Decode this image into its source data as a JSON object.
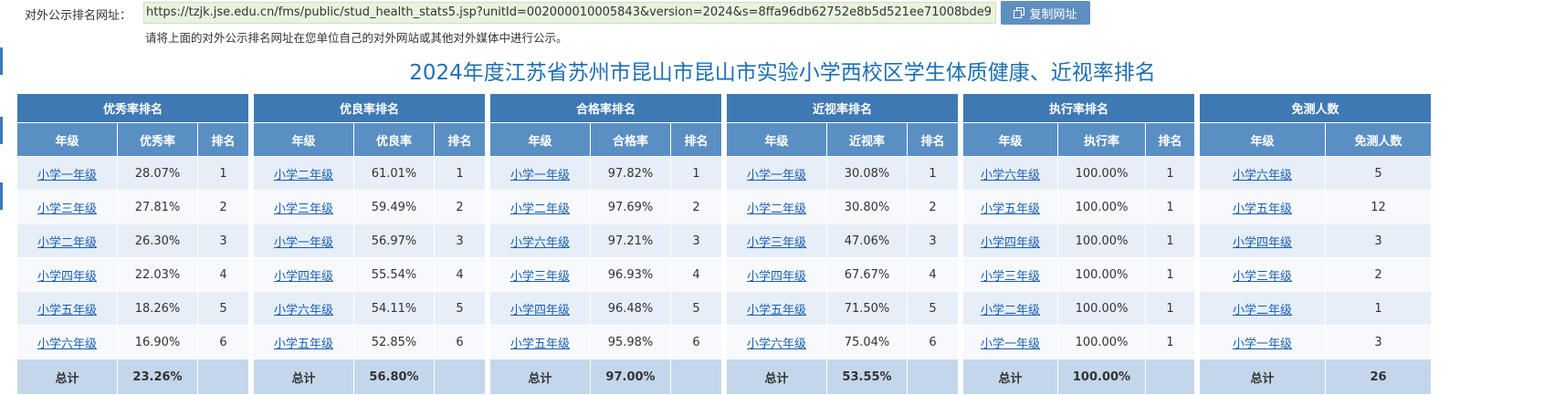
{
  "header": {
    "url_label": "对外公示排名网址：",
    "url": "https://tzjk.jse.edu.cn/fms/public/stud_health_stats5.jsp?unitId=002000010005843&version=2024&s=8ffa96db62752e8b5d521ee71008bde9",
    "copy_button": "复制网址",
    "hint": "请将上面的对外公示排名网址在您单位自己的对外网站或其他对外媒体中进行公示。"
  },
  "title": "2024年度江苏省苏州市昆山市昆山市实验小学西校区学生体质健康、近视率排名",
  "tables": [
    {
      "title": "优秀率排名",
      "col_grade": "年级",
      "col_value": "优秀率",
      "col_rank": "排名",
      "rows": [
        {
          "grade": "小学一年级",
          "value": "28.07%",
          "rank": "1"
        },
        {
          "grade": "小学三年级",
          "value": "27.81%",
          "rank": "2"
        },
        {
          "grade": "小学二年级",
          "value": "26.30%",
          "rank": "3"
        },
        {
          "grade": "小学四年级",
          "value": "22.03%",
          "rank": "4"
        },
        {
          "grade": "小学五年级",
          "value": "18.26%",
          "rank": "5"
        },
        {
          "grade": "小学六年级",
          "value": "16.90%",
          "rank": "6"
        }
      ],
      "total_label": "总计",
      "total_value": "23.26%"
    },
    {
      "title": "优良率排名",
      "col_grade": "年级",
      "col_value": "优良率",
      "col_rank": "排名",
      "rows": [
        {
          "grade": "小学二年级",
          "value": "61.01%",
          "rank": "1"
        },
        {
          "grade": "小学三年级",
          "value": "59.49%",
          "rank": "2"
        },
        {
          "grade": "小学一年级",
          "value": "56.97%",
          "rank": "3"
        },
        {
          "grade": "小学四年级",
          "value": "55.54%",
          "rank": "4"
        },
        {
          "grade": "小学六年级",
          "value": "54.11%",
          "rank": "5"
        },
        {
          "grade": "小学五年级",
          "value": "52.85%",
          "rank": "6"
        }
      ],
      "total_label": "总计",
      "total_value": "56.80%"
    },
    {
      "title": "合格率排名",
      "col_grade": "年级",
      "col_value": "合格率",
      "col_rank": "排名",
      "rows": [
        {
          "grade": "小学一年级",
          "value": "97.82%",
          "rank": "1"
        },
        {
          "grade": "小学二年级",
          "value": "97.69%",
          "rank": "2"
        },
        {
          "grade": "小学六年级",
          "value": "97.21%",
          "rank": "3"
        },
        {
          "grade": "小学三年级",
          "value": "96.93%",
          "rank": "4"
        },
        {
          "grade": "小学四年级",
          "value": "96.48%",
          "rank": "5"
        },
        {
          "grade": "小学五年级",
          "value": "95.98%",
          "rank": "6"
        }
      ],
      "total_label": "总计",
      "total_value": "97.00%"
    },
    {
      "title": "近视率排名",
      "col_grade": "年级",
      "col_value": "近视率",
      "col_rank": "排名",
      "rows": [
        {
          "grade": "小学一年级",
          "value": "30.08%",
          "rank": "1"
        },
        {
          "grade": "小学二年级",
          "value": "30.80%",
          "rank": "2"
        },
        {
          "grade": "小学三年级",
          "value": "47.06%",
          "rank": "3"
        },
        {
          "grade": "小学四年级",
          "value": "67.67%",
          "rank": "4"
        },
        {
          "grade": "小学五年级",
          "value": "71.50%",
          "rank": "5"
        },
        {
          "grade": "小学六年级",
          "value": "75.04%",
          "rank": "6"
        }
      ],
      "total_label": "总计",
      "total_value": "53.55%"
    },
    {
      "title": "执行率排名",
      "col_grade": "年级",
      "col_value": "执行率",
      "col_rank": "排名",
      "rows": [
        {
          "grade": "小学六年级",
          "value": "100.00%",
          "rank": "1"
        },
        {
          "grade": "小学五年级",
          "value": "100.00%",
          "rank": "1"
        },
        {
          "grade": "小学四年级",
          "value": "100.00%",
          "rank": "1"
        },
        {
          "grade": "小学三年级",
          "value": "100.00%",
          "rank": "1"
        },
        {
          "grade": "小学二年级",
          "value": "100.00%",
          "rank": "1"
        },
        {
          "grade": "小学一年级",
          "value": "100.00%",
          "rank": "1"
        }
      ],
      "total_label": "总计",
      "total_value": "100.00%"
    },
    {
      "title": "免测人数",
      "col_grade": "年级",
      "col_value": "免测人数",
      "rows": [
        {
          "grade": "小学六年级",
          "value": "5"
        },
        {
          "grade": "小学五年级",
          "value": "12"
        },
        {
          "grade": "小学四年级",
          "value": "3"
        },
        {
          "grade": "小学三年级",
          "value": "2"
        },
        {
          "grade": "小学二年级",
          "value": "1"
        },
        {
          "grade": "小学一年级",
          "value": "3"
        }
      ],
      "total_label": "总计",
      "total_value": "26"
    }
  ]
}
